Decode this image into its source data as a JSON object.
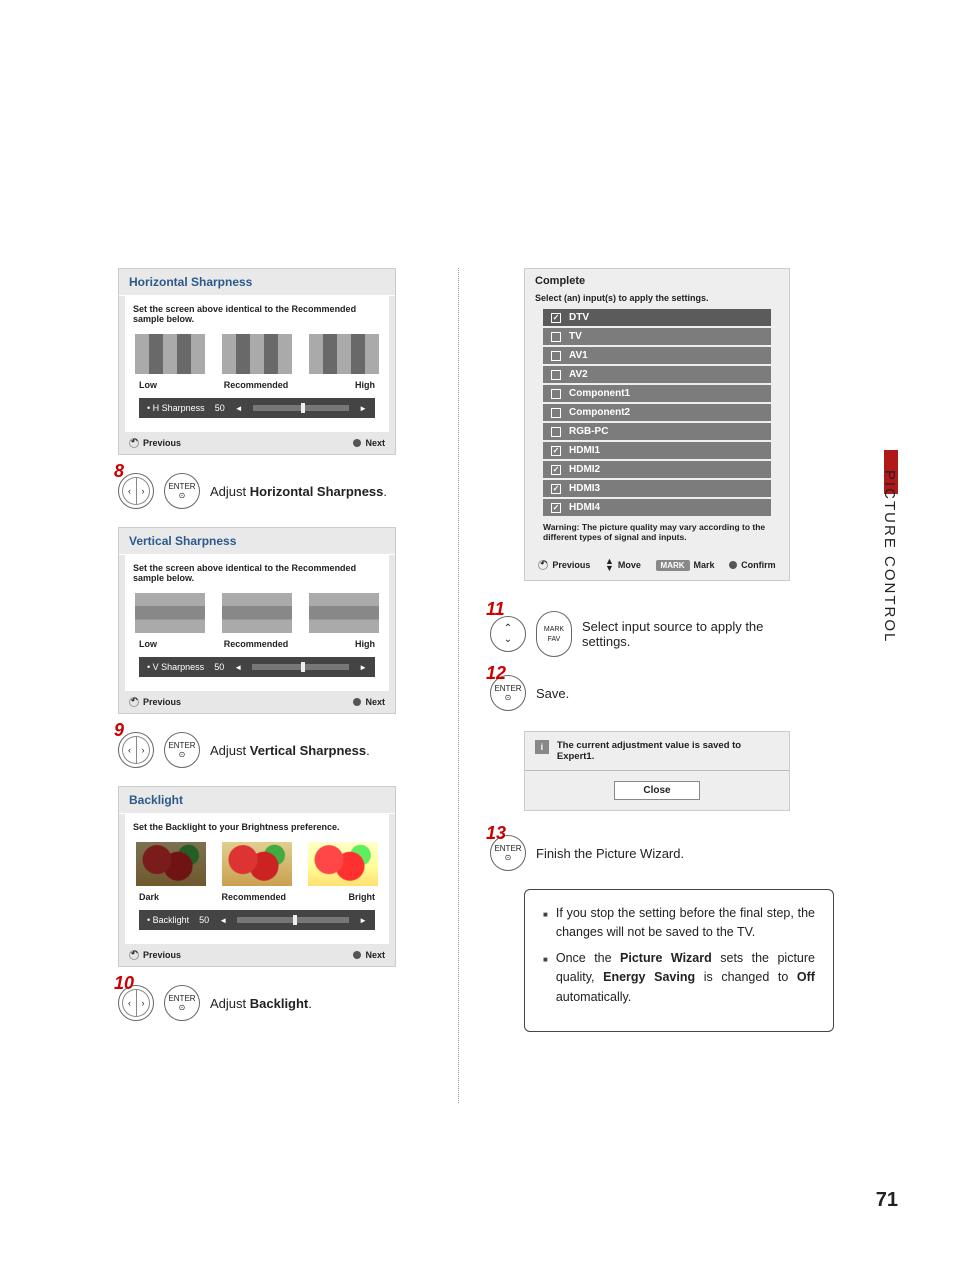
{
  "side_label": "PICTURE CONTROL",
  "page_number": "71",
  "panels": {
    "hsharp": {
      "title": "Horizontal Sharpness",
      "instr": "Set the screen above identical to the Recommended sample below.",
      "low": "Low",
      "rec": "Recommended",
      "high": "High",
      "slider_label": "• H Sharpness",
      "slider_val": "50",
      "prev": "Previous",
      "next": "Next"
    },
    "vsharp": {
      "title": "Vertical Sharpness",
      "instr": "Set the screen above identical to the Recommended sample below.",
      "low": "Low",
      "rec": "Recommended",
      "high": "High",
      "slider_label": "• V Sharpness",
      "slider_val": "50",
      "prev": "Previous",
      "next": "Next"
    },
    "backlight": {
      "title": "Backlight",
      "instr": "Set the Backlight to your Brightness preference.",
      "low": "Dark",
      "rec": "Recommended",
      "high": "Bright",
      "slider_label": "• Backlight",
      "slider_val": "50",
      "prev": "Previous",
      "next": "Next"
    }
  },
  "steps": {
    "s8": {
      "num": "8",
      "enter": "ENTER",
      "pre": "Adjust ",
      "bold": "Horizontal Sharpness",
      "post": "."
    },
    "s9": {
      "num": "9",
      "enter": "ENTER",
      "pre": "Adjust ",
      "bold": "Vertical Sharpness",
      "post": "."
    },
    "s10": {
      "num": "10",
      "enter": "ENTER",
      "pre": "Adjust ",
      "bold": "Backlight",
      "post": "."
    },
    "s11": {
      "num": "11",
      "mark": "MARK",
      "fav": "FAV",
      "text": "Select input source to apply the settings."
    },
    "s12": {
      "num": "12",
      "enter": "ENTER",
      "text": "Save."
    },
    "s13": {
      "num": "13",
      "enter": "ENTER",
      "text": "Finish the Picture Wizard."
    }
  },
  "complete": {
    "title": "Complete",
    "sub": "Select (an) input(s) to apply the settings.",
    "inputs": [
      {
        "label": "DTV",
        "checked": true,
        "sel": true
      },
      {
        "label": "TV",
        "checked": false
      },
      {
        "label": "AV1",
        "checked": false
      },
      {
        "label": "AV2",
        "checked": false
      },
      {
        "label": "Component1",
        "checked": false
      },
      {
        "label": "Component2",
        "checked": false
      },
      {
        "label": "RGB-PC",
        "checked": false
      },
      {
        "label": "HDMI1",
        "checked": true
      },
      {
        "label": "HDMI2",
        "checked": true
      },
      {
        "label": "HDMI3",
        "checked": true
      },
      {
        "label": "HDMI4",
        "checked": true
      }
    ],
    "warn": "Warning: The picture quality may vary according to the different types of signal and inputs.",
    "prev": "Previous",
    "move": "Move",
    "markbtn": "MARK",
    "mark": "Mark",
    "confirm": "Confirm"
  },
  "saved": {
    "text": "The current adjustment value is saved to Expert1.",
    "close": "Close"
  },
  "notes": {
    "n1a": "If you stop the setting before the final step, the changes will not be saved to the TV.",
    "n2a": "Once the ",
    "n2b": "Picture Wizard",
    "n2c": " sets the picture quality, ",
    "n2d": "Energy Saving",
    "n2e": " is changed to ",
    "n2f": "Off",
    "n2g": " automatically."
  }
}
